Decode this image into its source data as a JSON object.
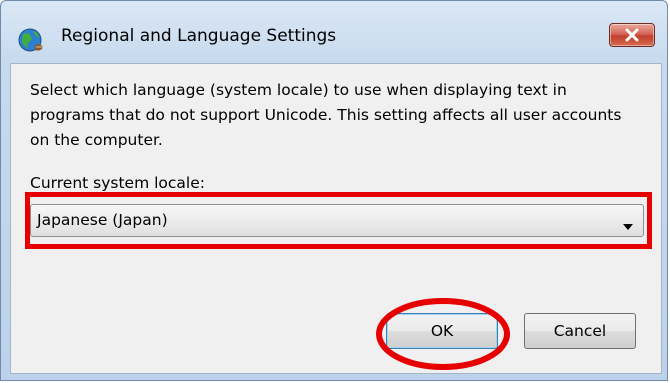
{
  "window": {
    "title": "Regional and Language Settings",
    "title_icon": "globe-icon",
    "close_icon": "close-icon"
  },
  "content": {
    "description": "Select which language (system locale) to use when displaying text in programs that do not support Unicode. This setting affects all user accounts on the computer.",
    "locale_label": "Current system locale:",
    "locale_value": "Japanese (Japan)",
    "dropdown_icon": "chevron-down-icon"
  },
  "buttons": {
    "ok_label": "OK",
    "cancel_label": "Cancel"
  },
  "annotations": {
    "highlight_color": "#e60000"
  }
}
